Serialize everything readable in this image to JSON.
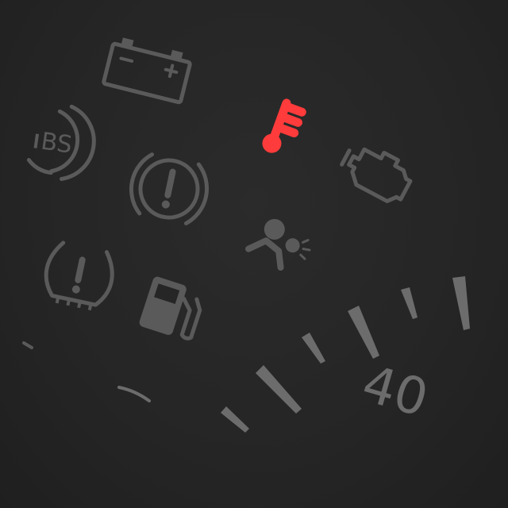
{
  "cluster": {
    "colors": {
      "background": "#262626",
      "inactive_lamp": "#5a5a5a",
      "warning_lamp": "#ff3b3b",
      "tick": "#6c6c6c"
    },
    "lamps": [
      {
        "name": "battery-warning-icon",
        "state": "off"
      },
      {
        "name": "abs-warning-icon",
        "text": "BS",
        "state": "off"
      },
      {
        "name": "coolant-temperature-warning-icon",
        "state": "on"
      },
      {
        "name": "brake-warning-icon",
        "state": "off"
      },
      {
        "name": "check-engine-icon",
        "state": "off"
      },
      {
        "name": "airbag-warning-icon",
        "state": "off"
      },
      {
        "name": "tire-pressure-warning-icon",
        "state": "off"
      },
      {
        "name": "fuel-level-icon",
        "state": "off"
      }
    ],
    "speedometer": {
      "label": "40"
    }
  }
}
